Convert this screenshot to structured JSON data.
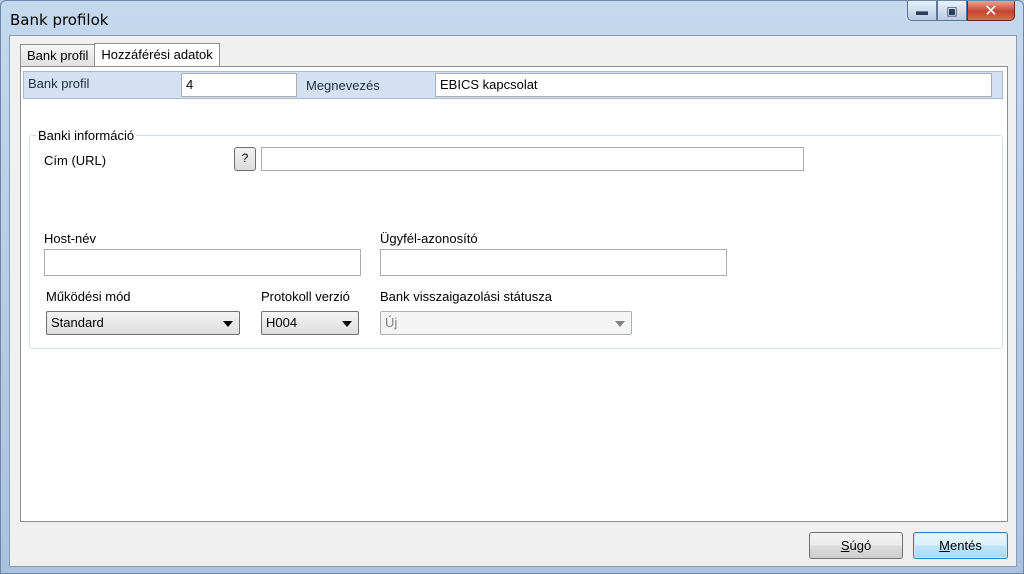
{
  "window": {
    "title": "Bank profilok"
  },
  "tabs": [
    {
      "label": "Bank profil",
      "active": false
    },
    {
      "label": "Hozzáférési adatok",
      "active": true
    }
  ],
  "profile": {
    "bank_profil_label": "Bank profil",
    "bank_profil_value": "4",
    "megnevezes_label": "Megnevezés",
    "megnevezes_value": "EBICS kapcsolat"
  },
  "bank_info": {
    "group_label": "Banki információ",
    "url_label": "Cím (URL)",
    "help_button": "?",
    "url_value": "",
    "host_label": "Host-név",
    "host_value": "",
    "client_id_label": "Ügyfél-azonosító",
    "client_id_value": "",
    "mode_label": "Működési mód",
    "mode_value": "Standard",
    "protocol_label": "Protokoll verzió",
    "protocol_value": "H004",
    "ack_status_label": "Bank visszaigazolási státusza",
    "ack_status_value": "Új"
  },
  "buttons": {
    "help_first": "S",
    "help_rest": "úgó",
    "save_first": "M",
    "save_rest": "entés"
  }
}
